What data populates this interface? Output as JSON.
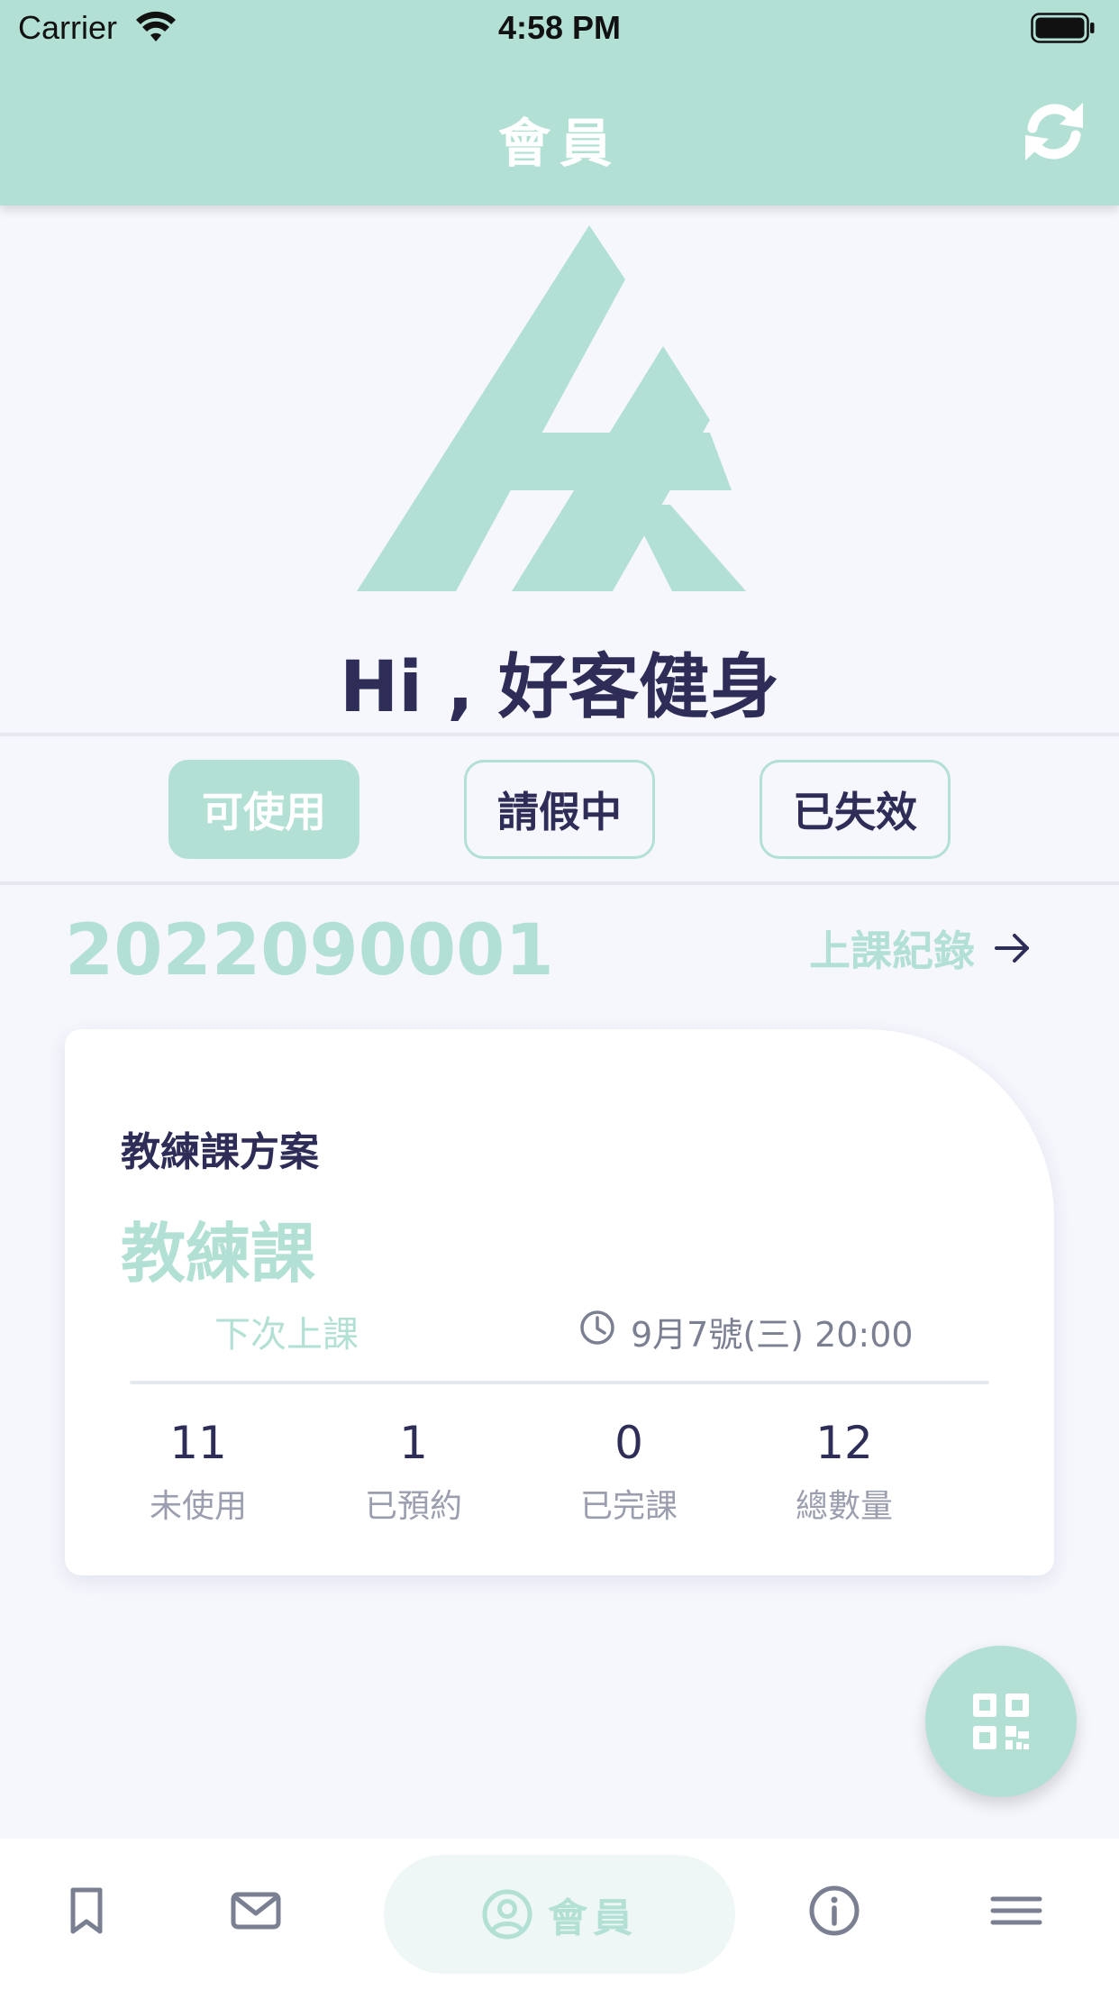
{
  "status_bar": {
    "carrier": "Carrier",
    "time": "4:58 PM"
  },
  "header": {
    "title": "會員",
    "refresh_icon": "refresh-icon"
  },
  "profile": {
    "greeting": "Hi , 好客健身"
  },
  "tabs": [
    {
      "label": "可使用",
      "active": true
    },
    {
      "label": "請假中",
      "active": false
    },
    {
      "label": "已失效",
      "active": false
    }
  ],
  "member": {
    "id": "2022090001",
    "records_label": "上課紀錄"
  },
  "card": {
    "plan_label": "教練課方案",
    "plan_name": "教練課",
    "next_label": "下次上課",
    "next_time": "9月7號(三) 20:00",
    "stats": [
      {
        "value": "11",
        "label": "未使用"
      },
      {
        "value": "1",
        "label": "已預約"
      },
      {
        "value": "0",
        "label": "已完課"
      },
      {
        "value": "12",
        "label": "總數量"
      }
    ]
  },
  "bottom_nav": {
    "items": [
      {
        "icon": "bookmark-icon"
      },
      {
        "icon": "mail-icon"
      },
      {
        "icon": "user-circle-icon",
        "label": "會員",
        "active": true
      },
      {
        "icon": "info-icon"
      },
      {
        "icon": "menu-icon"
      }
    ]
  },
  "colors": {
    "accent": "#b3e0d5",
    "text_dark": "#2e2d57",
    "text_muted": "#9a9eae",
    "background": "#f6f7fc"
  }
}
